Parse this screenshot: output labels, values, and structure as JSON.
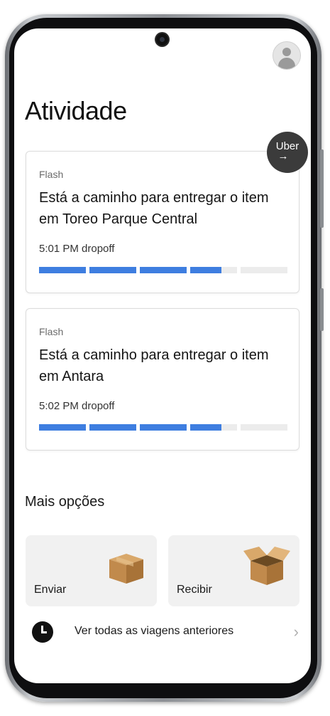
{
  "header": {
    "title": "Atividade"
  },
  "badge": {
    "brand": "Uber",
    "arrow": "→"
  },
  "deliveries": [
    {
      "category": "Flash",
      "message": "Está a caminho para entregar o item em Toreo Parque Central",
      "time": "5:01 PM dropoff",
      "progress_segments": [
        1,
        1,
        1,
        0.66,
        0
      ]
    },
    {
      "category": "Flash",
      "message": "Está a caminho para entregar o item em Antara",
      "time": "5:02 PM dropoff",
      "progress_segments": [
        1,
        1,
        1,
        0.66,
        0
      ]
    }
  ],
  "more": {
    "title": "Mais opções",
    "tiles": [
      {
        "label": "Enviar",
        "icon": "closed-box-icon"
      },
      {
        "label": "Recibir",
        "icon": "open-box-icon"
      }
    ]
  },
  "history": {
    "label": "Ver todas as viagens anteriores",
    "icon": "clock-icon",
    "chevron": "›"
  },
  "colors": {
    "progress": "#3e7ee0",
    "progress_empty": "#ececec",
    "badge": "#3b3b3b"
  }
}
